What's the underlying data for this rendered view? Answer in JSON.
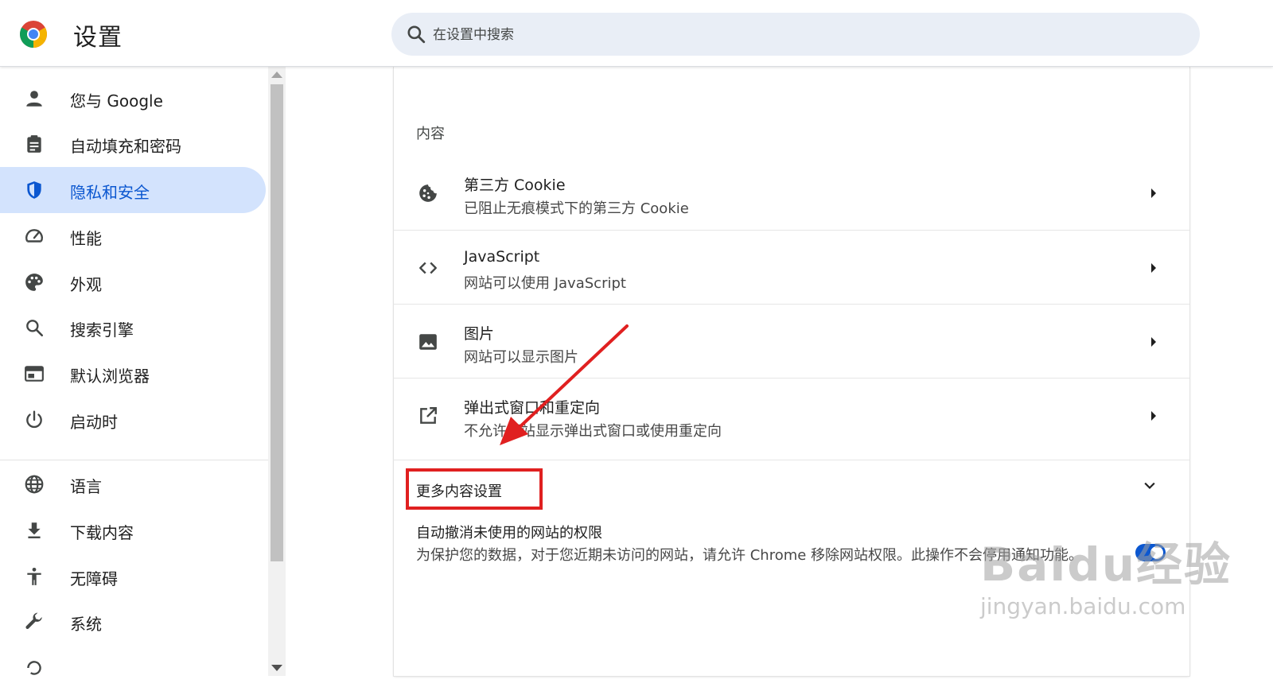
{
  "header": {
    "title": "设置",
    "search_placeholder": "在设置中搜索"
  },
  "sidebar": {
    "items": [
      {
        "label": "您与 Google",
        "icon": "person-icon"
      },
      {
        "label": "自动填充和密码",
        "icon": "clipboard-icon"
      },
      {
        "label": "隐私和安全",
        "icon": "shield-icon",
        "active": true
      },
      {
        "label": "性能",
        "icon": "speedometer-icon"
      },
      {
        "label": "外观",
        "icon": "palette-icon"
      },
      {
        "label": "搜索引擎",
        "icon": "search-icon"
      },
      {
        "label": "默认浏览器",
        "icon": "browser-icon"
      },
      {
        "label": "启动时",
        "icon": "power-icon"
      },
      {
        "label": "语言",
        "icon": "globe-icon"
      },
      {
        "label": "下载内容",
        "icon": "download-icon"
      },
      {
        "label": "无障碍",
        "icon": "accessibility-icon"
      },
      {
        "label": "系统",
        "icon": "wrench-icon"
      }
    ]
  },
  "content": {
    "section_title": "内容",
    "rows": [
      {
        "title": "第三方 Cookie",
        "subtitle": "已阻止无痕模式下的第三方 Cookie",
        "icon": "cookie-icon"
      },
      {
        "title": "JavaScript",
        "subtitle": "网站可以使用 JavaScript",
        "icon": "code-icon"
      },
      {
        "title": "图片",
        "subtitle": "网站可以显示图片",
        "icon": "image-icon"
      },
      {
        "title": "弹出式窗口和重定向",
        "subtitle": "不允许网站显示弹出式窗口或使用重定向",
        "icon": "open-in-new-icon"
      }
    ],
    "more_label": "更多内容设置",
    "permission": {
      "title": "自动撤消未使用的网站的权限",
      "description": "为保护您的数据，对于您近期未访问的网站，请允许 Chrome 移除网站权限。此操作不会停用通知功能。",
      "enabled": true
    }
  },
  "colors": {
    "accent": "#0b57d0",
    "active_nav_bg": "#d3e3fd",
    "annotation": "#e02020"
  },
  "watermark": {
    "main": "Baidu经验",
    "sub": "jingyan.baidu.com"
  }
}
